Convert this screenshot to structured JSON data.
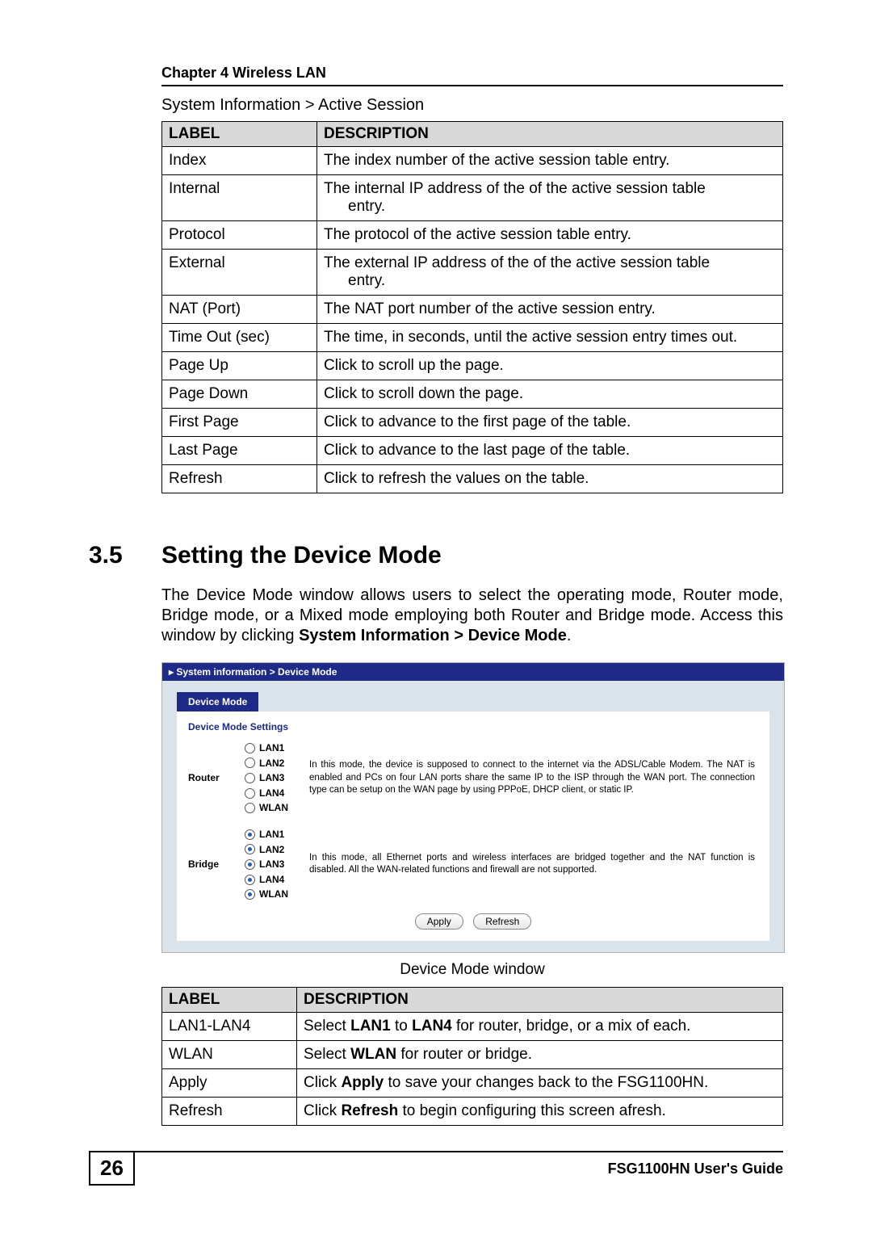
{
  "header": {
    "chapter_line": "Chapter 4 Wireless LAN"
  },
  "breadcrumb1": "System Information > Active Session",
  "table1": {
    "head_label": "LABEL",
    "head_desc": "DESCRIPTION",
    "rows": [
      {
        "label": "Index",
        "desc": "The index number of the active session table entry."
      },
      {
        "label": "Internal",
        "desc_lead": "The internal IP address of the of the active session table",
        "desc_tail": "entry."
      },
      {
        "label": "Protocol",
        "desc": "The protocol of the active session table entry."
      },
      {
        "label": "External",
        "desc_lead": "The external IP address of the of the active session table",
        "desc_tail": "entry."
      },
      {
        "label": "NAT (Port)",
        "desc": "The NAT port number of the active session entry."
      },
      {
        "label": "Time Out (sec)",
        "desc": "The time, in seconds, until the active session entry times out."
      },
      {
        "label": "Page Up",
        "desc": "Click to scroll up the page."
      },
      {
        "label": "Page Down",
        "desc": "Click to scroll down the page."
      },
      {
        "label": "First Page",
        "desc": "Click to advance to the first page of the table."
      },
      {
        "label": "Last Page",
        "desc": "Click to advance to the last page of the table."
      },
      {
        "label": "Refresh",
        "desc": "Click to refresh the values on the table."
      }
    ]
  },
  "section": {
    "num": "3.5",
    "title": "Setting the Device Mode",
    "intro_pre": "The Device Mode window allows users to select the operating mode, Router mode, Bridge mode, or a Mixed mode employing both Router and Bridge mode. Access this window by clicking ",
    "intro_bold": "System Information > Device Mode",
    "intro_post": "."
  },
  "ui": {
    "titlebar": "System information > Device Mode",
    "tab": "Device Mode",
    "subtitle": "Device Mode Settings",
    "router": {
      "name": "Router",
      "ports": [
        "LAN1",
        "LAN2",
        "LAN3",
        "LAN4",
        "WLAN"
      ],
      "selected": [
        false,
        false,
        false,
        false,
        false
      ],
      "desc": "In this mode, the device is supposed to connect to the internet via the ADSL/Cable Modem. The NAT is enabled and PCs on four LAN ports share the same IP to the ISP through the WAN port. The connection type can be setup on the WAN page by using PPPoE, DHCP client, or static IP."
    },
    "bridge": {
      "name": "Bridge",
      "ports": [
        "LAN1",
        "LAN2",
        "LAN3",
        "LAN4",
        "WLAN"
      ],
      "selected": [
        true,
        true,
        true,
        true,
        true
      ],
      "desc": "In this mode, all Ethernet ports and wireless interfaces are bridged together and the NAT function is disabled. All the WAN-related functions and firewall are not supported."
    },
    "apply_label": "Apply",
    "refresh_label": "Refresh"
  },
  "figure_caption": "Device Mode window",
  "table2": {
    "head_label": "LABEL",
    "head_desc": "DESCRIPTION",
    "rows": [
      {
        "label": "LAN1-LAN4",
        "pre": "Select ",
        "b1": "LAN1",
        "mid": " to ",
        "b2": "LAN4",
        "post": " for router, bridge, or a mix of each."
      },
      {
        "label": "WLAN",
        "pre": "Select ",
        "b1": "WLAN",
        "post": " for router or bridge."
      },
      {
        "label": "Apply",
        "pre": "Click ",
        "b1": "Apply",
        "post": " to save your changes back to the FSG1100HN."
      },
      {
        "label": "Refresh",
        "pre": "Click ",
        "b1": "Refresh",
        "post": " to begin configuring this screen afresh."
      }
    ]
  },
  "footer": {
    "page_num": "26",
    "guide": "FSG1100HN User's Guide"
  }
}
